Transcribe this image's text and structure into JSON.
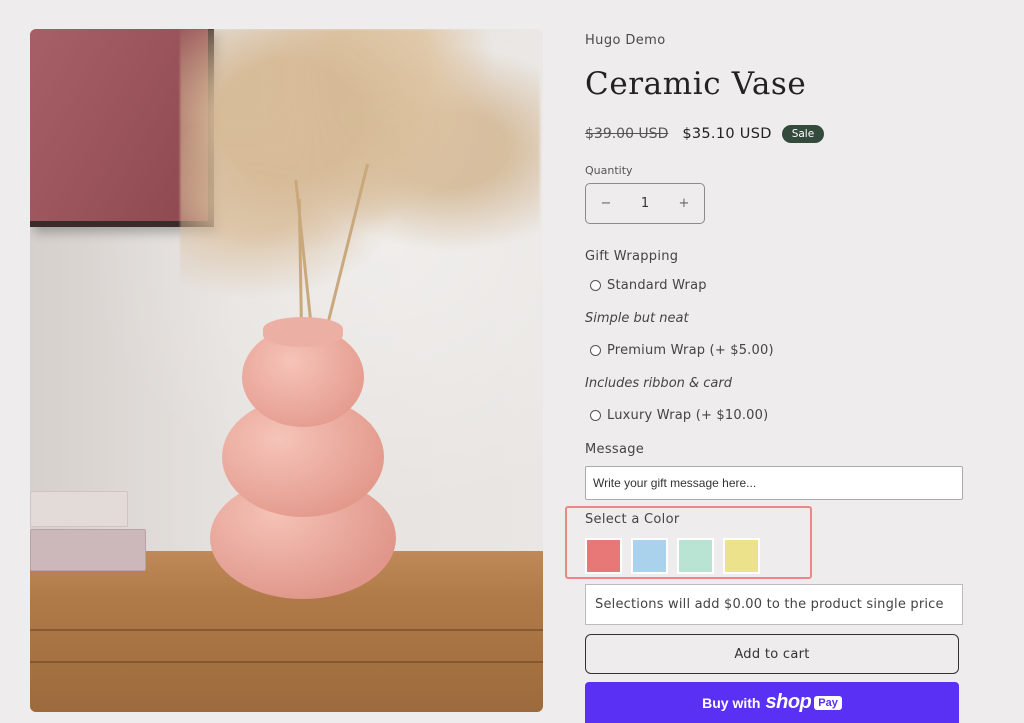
{
  "product": {
    "brand": "Hugo Demo",
    "title": "Ceramic Vase",
    "old_price": "$39.00 USD",
    "sale_price": "$35.10 USD",
    "badge": "Sale"
  },
  "quantity": {
    "label": "Quantity",
    "value": "1",
    "minus_symbol": "−",
    "plus_symbol": "+"
  },
  "gift_wrapping": {
    "label": "Gift Wrapping",
    "options": [
      {
        "label": "Standard Wrap",
        "note": "Simple but neat"
      },
      {
        "label": "Premium Wrap (+ $5.00)",
        "note": "Includes ribbon & card"
      },
      {
        "label": "Luxury Wrap (+ $10.00)"
      }
    ]
  },
  "message": {
    "label": "Message",
    "placeholder": "Write your gift message here..."
  },
  "color": {
    "label": "Select a Color",
    "swatches": [
      "#e87878",
      "#aad2ec",
      "#b9e3d2",
      "#ece28c"
    ]
  },
  "selection_info": "Selections will add $0.00 to the product single price",
  "actions": {
    "add_to_cart": "Add to cart",
    "buy_with": "Buy with",
    "shop": "shop",
    "pay": "Pay"
  }
}
